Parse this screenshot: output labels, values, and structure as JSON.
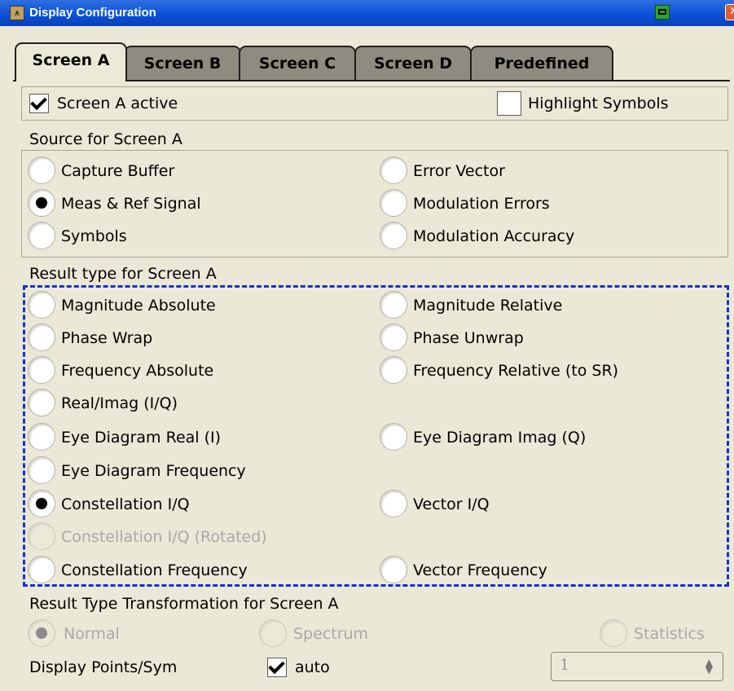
{
  "window": {
    "title": "Display Configuration"
  },
  "tabs": [
    "Screen A",
    "Screen B",
    "Screen C",
    "Screen D",
    "Predefined"
  ],
  "screen_active": {
    "label": "Screen A active",
    "checked": true
  },
  "highlight_symbols": {
    "label": "Highlight Symbols",
    "checked": false
  },
  "source": {
    "title": "Source for Screen A",
    "options": [
      "Capture Buffer",
      "Error Vector",
      "Meas & Ref Signal",
      "Modulation Errors",
      "Symbols",
      "Modulation Accuracy"
    ],
    "selected": "Meas & Ref Signal"
  },
  "result_type": {
    "title": "Result type for Screen A",
    "options": [
      "Magnitude Absolute",
      "Magnitude Relative",
      "Phase Wrap",
      "Phase Unwrap",
      "Frequency Absolute",
      "Frequency Relative (to SR)",
      "Real/Imag (I/Q)",
      "Eye Diagram Real (I)",
      "Eye Diagram Imag (Q)",
      "Eye Diagram Frequency",
      "Constellation I/Q",
      "Vector I/Q",
      "Constellation I/Q (Rotated)",
      "Constellation Frequency",
      "Vector Frequency"
    ],
    "selected": "Constellation I/Q",
    "disabled": [
      "Constellation I/Q (Rotated)"
    ]
  },
  "transformation": {
    "title": "Result Type Transformation for Screen A",
    "options": [
      "Normal",
      "Spectrum",
      "Statistics"
    ],
    "selected": "Normal"
  },
  "display_points": {
    "label": "Display Points/Sym",
    "auto_label": "auto",
    "auto_checked": true,
    "value": "1"
  },
  "colors": {
    "titlebar": "#0a4fd6",
    "panel": "#ece9d8",
    "focus": "#1531cc"
  }
}
